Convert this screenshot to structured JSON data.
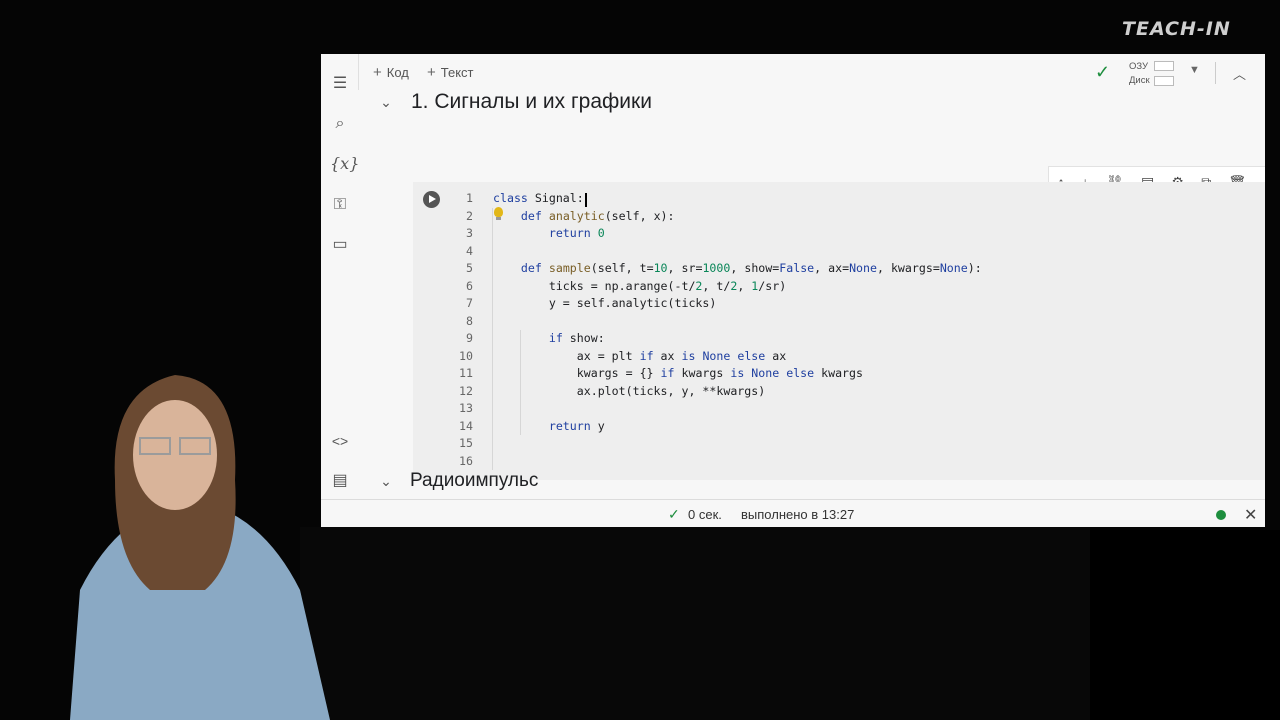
{
  "logo": {
    "text": "TEACH-IN"
  },
  "toolbar": {
    "add_code": "Код",
    "add_text": "Текст",
    "ram_label": "ОЗУ",
    "disk_label": "Диск"
  },
  "sections": {
    "title1": "1. Сигналы и их графики",
    "title2": "Радиоимпульс"
  },
  "code": {
    "line_numbers": [
      "1",
      "2",
      "3",
      "4",
      "5",
      "6",
      "7",
      "8",
      "9",
      "10",
      "11",
      "12",
      "13",
      "14",
      "15",
      "16"
    ]
  },
  "status": {
    "time": "0 сек.",
    "done": "выполнено в 13:27"
  },
  "icons": [
    "toc-icon",
    "search-icon",
    "variables-icon",
    "key-icon",
    "folder-icon",
    "code-snippets-icon",
    "terminal-icon",
    "arrow-up-icon",
    "arrow-down-icon",
    "link-icon",
    "comment-icon",
    "gear-icon",
    "mirror-cell-icon",
    "trash-icon",
    "more-icon"
  ],
  "colors": {
    "accent_green": "#1e8e3e",
    "keyword": "#2040a0",
    "function": "#795e26",
    "number": "#098658"
  }
}
